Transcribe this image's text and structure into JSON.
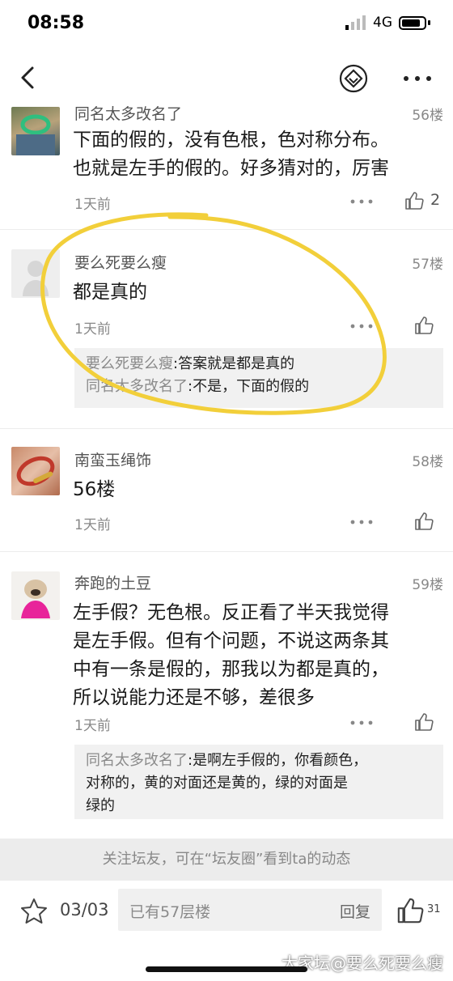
{
  "status_bar": {
    "time": "08:58",
    "network": "4G"
  },
  "nav": {
    "back_icon": "chevron-left-icon",
    "badge_icon": "diamond-badge-icon",
    "more_icon": "more-dots-icon"
  },
  "floors": [
    {
      "username": "同名太多改名了",
      "floor": "56楼",
      "lines": [
        "下面的假的，没有色根，色对称分布。",
        "也就是左手的假的。好多猜对的，厉害"
      ],
      "time": "1天前",
      "likes": "2"
    },
    {
      "username": "要么死要么瘦",
      "floor": "57楼",
      "lines": [
        "都是真的"
      ],
      "time": "1天前",
      "replies": [
        {
          "name": "要么死要么瘦",
          "text": ":答案就是都是真的"
        },
        {
          "name": "同名太多改名了",
          "text": ":不是，下面的假的"
        }
      ]
    },
    {
      "username": "南蛮玉绳饰",
      "floor": "58楼",
      "lines": [
        "56楼"
      ],
      "time": "1天前"
    },
    {
      "username": "奔跑的土豆",
      "floor": "59楼",
      "lines": [
        "左手假？无色根。反正看了半天我觉得",
        "是左手假。但有个问题，不说这两条其",
        "中有一条是假的，那我以为都是真的，",
        "所以说能力还是不够，差很多"
      ],
      "time": "1天前",
      "replies": [
        {
          "name": "同名太多改名了",
          "text": ":是啊左手假的，你看颜色，",
          "line2": "对称的，黄的对面还是黄的，绿的对面是",
          "line3": "绿的"
        }
      ]
    }
  ],
  "follow_tip": "关注坛友，可在“坛友圈”看到ta的动态",
  "bottom_bar": {
    "page": "03/03",
    "reply_placeholder": "已有57层楼",
    "reply_button": "回复",
    "likes": "31",
    "watermark": "大家坛@要么死要么瘦"
  },
  "colors": {
    "highlight": "#f2cf3a",
    "sub_reply_bg": "#f1f1f1"
  }
}
